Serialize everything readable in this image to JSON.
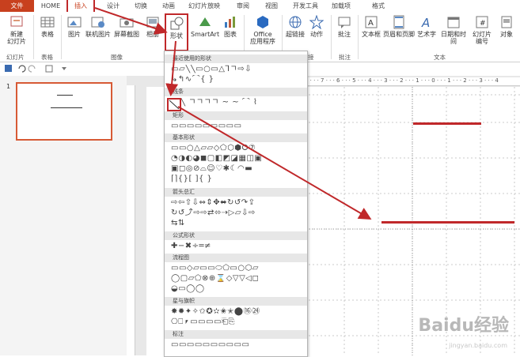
{
  "tabs": [
    "文件",
    "HOME",
    "插入",
    "设计",
    "切换",
    "动画",
    "幻灯片放映",
    "审阅",
    "视图",
    "开发工具",
    "加载项",
    "格式"
  ],
  "ribbon": {
    "new_slide": "新建\n幻灯片",
    "table": "表格",
    "picture": "图片",
    "online_picture": "联机图片",
    "screenshot": "屏幕截图",
    "album": "相册",
    "shapes": "形状",
    "smartart": "SmartArt",
    "chart": "图表",
    "office_apps": "Office\n应用程序",
    "hyperlink": "超链接",
    "action": "动作",
    "comment": "批注",
    "textbox": "文本框",
    "header_footer": "页眉和页脚",
    "wordart": "艺术字",
    "datetime": "日期和时间",
    "slide_number": "幻灯片\n编号",
    "object": "对象",
    "group_slides": "幻灯片",
    "group_tables": "表格",
    "group_images": "图像",
    "group_links": "接",
    "group_comments": "批注",
    "group_text": "文本"
  },
  "slide_panel": {
    "slide_number": "1"
  },
  "ruler_text": "8 · · · 7 · · · 6 · · · 5 · · · 4 · · · 3 · · · 2 · · · 1 · · · 0 · · · 1 · · · 2 · · · 3 · · · 4",
  "dropdown": {
    "recent": "最近使用的形状",
    "lines": "线条",
    "rect": "矩形",
    "basic": "基本形状",
    "arrows": "箭头总汇",
    "equation": "公式形状",
    "flowchart": "流程图",
    "stars": "星与旗帜",
    "callouts": "标注",
    "row_recent1": "▭▱╲╲▭○▭△⅂ㄱ⇨⇩",
    "row_recent2": "↳↰∿⌒{ }",
    "row_lines": "╲ ㄱㄱㄱㄱ ~ ~ ⌒ ⌇",
    "row_rect": "▭▭▭▭▭▭▭▭▭",
    "row_basic1": "▭▭○△▱▱◇⬠⬡⬢⭘⑦",
    "row_basic2": "◔◑◐◕◼▢◧◩◪▦◫▣",
    "row_basic3": "▣◻◎⊘⌓☺♡✱☾◠▬",
    "row_basic4": "⌈⌉{}[ ]{ }",
    "row_arrows1": "⇨⇦⇧⇩⇔⇕✥⬌↻↺↷⇪",
    "row_arrows2": "↻↺⤴⇨⇨⇄⬄⇢▷▱⇩⇨",
    "row_arrows3": "⇆⇅",
    "row_eq": "✚−✖÷═≠",
    "row_flow1": "▭▭◇▱▭▭⬭⬠▭○⬡▱",
    "row_flow2": "◯▢▱⬠⊗⊕⌛◇▽▽◁◻",
    "row_flow3": "◒▭◯◯",
    "row_stars1": "✸✹✦✧✩✪✫✬✭⬤⑯㉔",
    "row_stars2": "⎔⎕⎖▭▭▭▭⎗⎘",
    "row_callouts": "▭▭▭▭▭▭▭▭▭▭"
  },
  "watermark": "Baidu经验",
  "watermark_url": "jingyan.baidu.com",
  "colors": {
    "file_tab": "#c8401e",
    "highlight": "#c0282a",
    "line": "#c0282a"
  }
}
